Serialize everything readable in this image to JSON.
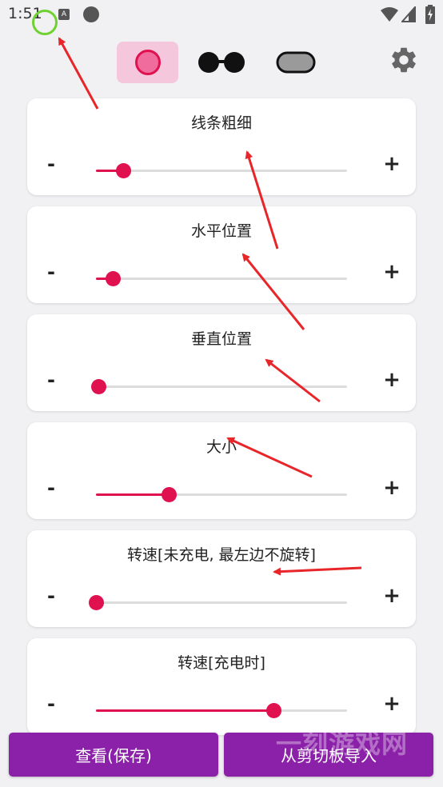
{
  "status_bar": {
    "time": "1:51",
    "notification_icon_label": "A"
  },
  "toolbar": {
    "shapes": [
      "circle",
      "glasses",
      "pill"
    ],
    "active_shape": "circle"
  },
  "sliders": [
    {
      "title": "线条粗细",
      "minus": "-",
      "plus": "+",
      "value": 0.11
    },
    {
      "title": "水平位置",
      "minus": "-",
      "plus": "+",
      "value": 0.07
    },
    {
      "title": "垂直位置",
      "minus": "-",
      "plus": "+",
      "value": 0.01
    },
    {
      "title": "大小",
      "minus": "-",
      "plus": "+",
      "value": 0.29
    },
    {
      "title": "转速[未充电, 最左边不旋转]",
      "minus": "-",
      "plus": "+",
      "value": 0.0
    },
    {
      "title": "转速[充电时]",
      "minus": "-",
      "plus": "+",
      "value": 0.71
    }
  ],
  "buttons": {
    "view_save": "查看(保存)",
    "import_clipboard": "从剪切板导入"
  },
  "watermark": "一刻游戏网",
  "colors": {
    "accent": "#e0114f",
    "button": "#8b21a8",
    "active_shape_bg": "#f5c7dc",
    "annotation": "#e8262a"
  }
}
